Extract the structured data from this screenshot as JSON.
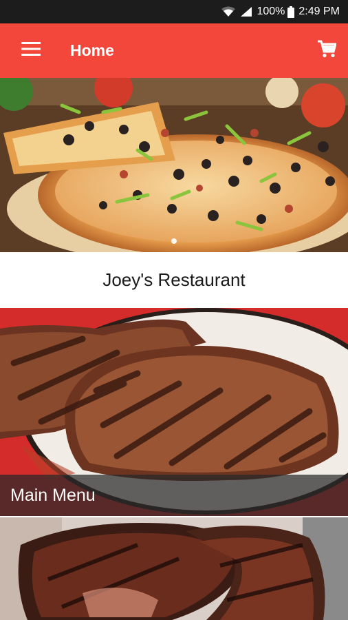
{
  "status_bar": {
    "battery": "100%",
    "time": "2:49 PM",
    "icons": [
      "wifi-icon",
      "signal-icon",
      "battery-icon"
    ]
  },
  "app_bar": {
    "title": "Home",
    "icons": [
      "menu-icon",
      "cart-icon"
    ],
    "background_color": "#f2473a"
  },
  "banner": {
    "image": "pizza",
    "page_indicator_count": 1
  },
  "restaurant": {
    "name": "Joey's Restaurant"
  },
  "menu_tiles": [
    {
      "label": "Main Menu",
      "image": "grilled steak"
    },
    {
      "label": "",
      "image": "grilled steak"
    }
  ]
}
